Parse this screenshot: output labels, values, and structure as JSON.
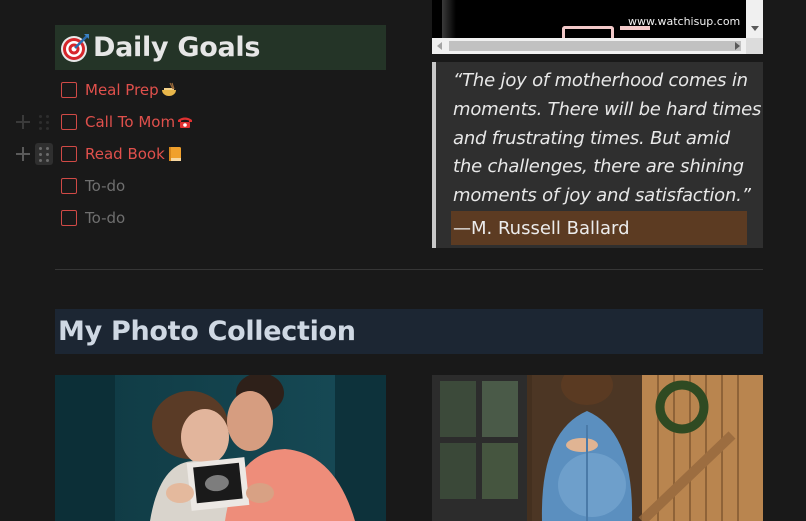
{
  "daily_goals": {
    "heading": "Daily Goals",
    "icon": "direct-hit-icon",
    "items": [
      {
        "label": "Meal Prep",
        "emoji_icon": "ramen-bowl-icon",
        "color": "#e0504c"
      },
      {
        "label": "Call To Mom",
        "emoji_icon": "telephone-icon",
        "color": "#e0504c"
      },
      {
        "label": "Read Book",
        "emoji_icon": "orange-book-icon",
        "color": "#e0504c"
      },
      {
        "label": "To-do",
        "color": "#6f6f6f"
      },
      {
        "label": "To-do",
        "color": "#6f6f6f"
      }
    ]
  },
  "video_embed": {
    "watermark": "www.watchisup.com"
  },
  "quote": {
    "text": "“The joy of motherhood comes in moments. There will be hard times and frustrating times. But amid the challenges, there are shining moments of joy and satisfaction.”",
    "author": "—M. Russell Ballard"
  },
  "photo_collection": {
    "heading": "My Photo Collection",
    "photos": [
      {
        "subject": "couple-with-ultrasound-photo"
      },
      {
        "subject": "pregnant-woman-denim-dress"
      }
    ]
  },
  "colors": {
    "background": "#191919",
    "goals_heading_bg": "#243427",
    "photo_heading_bg": "#1c2633",
    "quote_bg": "#2f2f2f",
    "author_highlight": "#5c3b22",
    "checkbox_red": "#d04a46"
  }
}
